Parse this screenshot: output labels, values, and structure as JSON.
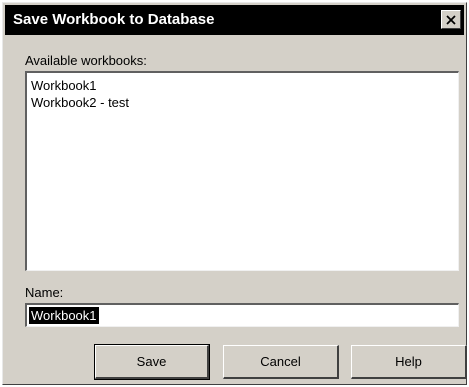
{
  "window": {
    "title": "Save Workbook to Database"
  },
  "workbooks": {
    "label": "Available workbooks:",
    "items": [
      "Workbook1",
      "Workbook2 - test"
    ]
  },
  "name_field": {
    "label": "Name:",
    "value": "Workbook1"
  },
  "buttons": {
    "save": "Save",
    "cancel": "Cancel",
    "help": "Help"
  },
  "icons": {
    "close": "close-icon"
  },
  "colors": {
    "title_bar": "#000000",
    "dialog_bg": "#d4d0c8",
    "selection": "#000000"
  }
}
